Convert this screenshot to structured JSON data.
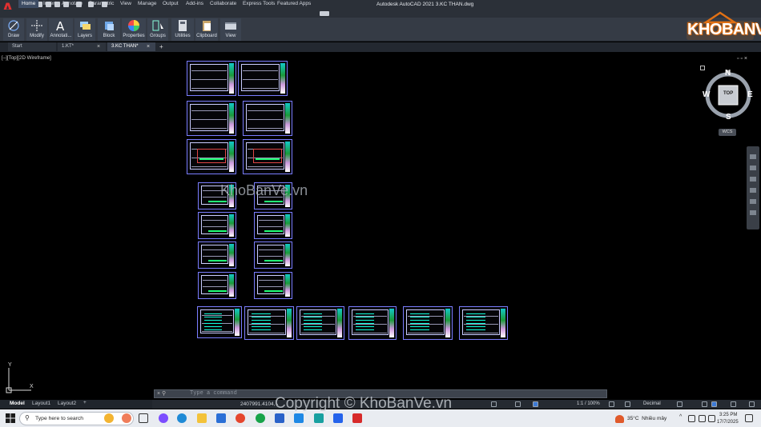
{
  "app": {
    "title": "Autodesk AutoCAD 2021   3.KC THAN.dwg",
    "logo_letter": "A"
  },
  "menu": [
    "Home",
    "Insert",
    "Annotate",
    "Parametric",
    "View",
    "Manage",
    "Output",
    "Add-ins",
    "Collaborate",
    "Express Tools",
    "Featured Apps"
  ],
  "ribbon": [
    "Draw",
    "Modify",
    "Annotati...",
    "Layers",
    "Block",
    "Properties",
    "Groups",
    "Utilities",
    "Clipboard",
    "View"
  ],
  "doc_tabs": [
    "Start",
    "1.KT*",
    "3.KC THAN*"
  ],
  "viewport_label": "[–][Top][2D Wireframe]",
  "watermark": "KhoBanVe.vn",
  "copyright": "Copyright © KhoBanVe.vn",
  "brand": "KHOBANVE",
  "viewcube": {
    "top": "TOP",
    "n": "N",
    "s": "S",
    "e": "E",
    "w": "W",
    "wcs": "WCS"
  },
  "ucs": {
    "x": "X",
    "y": "Y"
  },
  "layout_tabs": [
    "Model",
    "Layout1",
    "Layout2",
    "+"
  ],
  "command": {
    "placeholder": "Type a command"
  },
  "status": {
    "coords": "2407991.4104, -",
    "scale": "1:1 / 100%",
    "units": "Decimal"
  },
  "taskbar": {
    "search_placeholder": "Type here to search",
    "weather_temp": "35°C",
    "weather_text": "Nhiều mây",
    "time": "3:25 PM",
    "date": "17/7/2025"
  },
  "colors": {
    "accent": "#3d4c63",
    "sheet_border": "#7a7dff",
    "brand_orange": "#e07014"
  }
}
